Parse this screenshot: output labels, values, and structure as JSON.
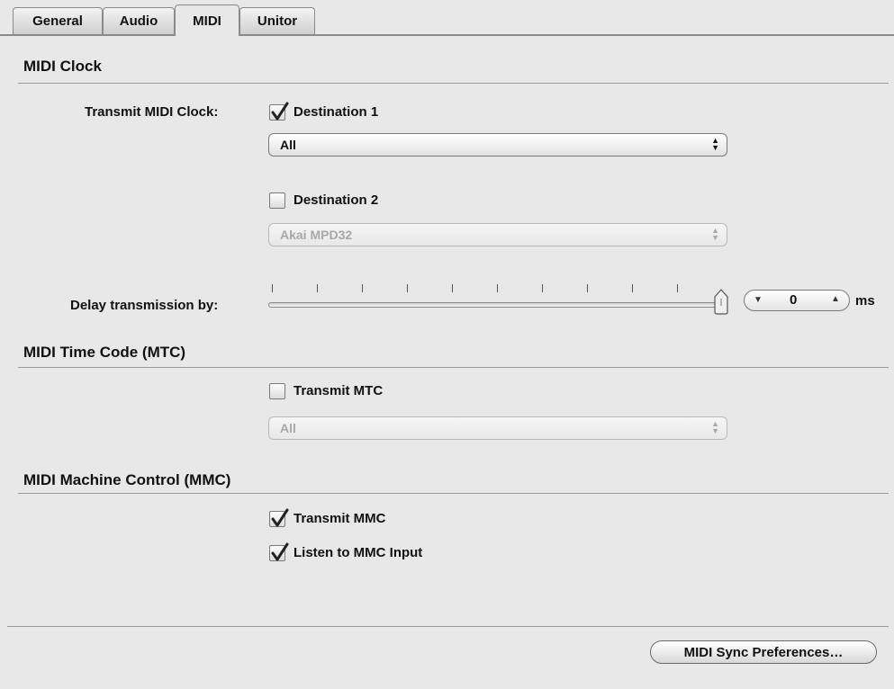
{
  "tabs": [
    {
      "label": "General"
    },
    {
      "label": "Audio"
    },
    {
      "label": "MIDI"
    },
    {
      "label": "Unitor"
    }
  ],
  "active_tab": "MIDI",
  "midi_clock": {
    "title": "MIDI Clock",
    "transmit_label": "Transmit MIDI Clock:",
    "destination1": {
      "label": "Destination 1",
      "checked": true,
      "popup_value": "All"
    },
    "destination2": {
      "label": "Destination 2",
      "checked": false,
      "popup_value": "Akai MPD32"
    },
    "delay_label": "Delay transmission by:",
    "delay_value": "0",
    "delay_unit": "ms",
    "slider_position": 1.0
  },
  "mtc": {
    "title": "MIDI Time Code (MTC)",
    "transmit_label": "Transmit MTC",
    "checked": false,
    "popup_value": "All"
  },
  "mmc": {
    "title": "MIDI Machine Control (MMC)",
    "transmit_label": "Transmit MMC",
    "transmit_checked": true,
    "listen_label": "Listen to MMC Input",
    "listen_checked": true
  },
  "sync_button_label": "MIDI Sync Preferences…",
  "colors": {
    "background": "#e8e8e8",
    "rule": "#9a9a9a"
  }
}
